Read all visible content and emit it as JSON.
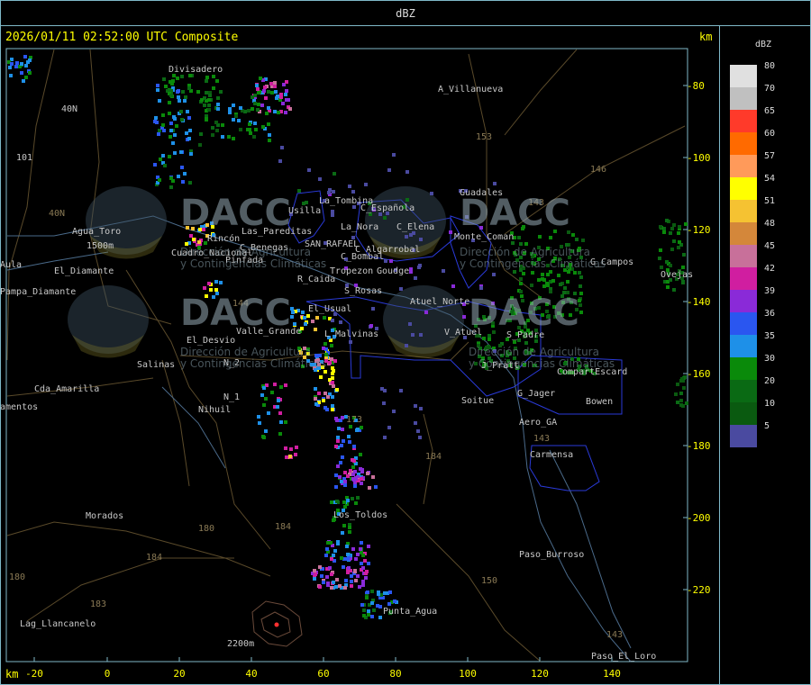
{
  "header": {
    "title": "dBZ"
  },
  "map": {
    "timestamp": "2026/01/11 02:52:00 UTC Composite",
    "unit_label": "km",
    "x_ticks": [
      "-20",
      "0",
      "20",
      "40",
      "60",
      "80",
      "100",
      "120",
      "140"
    ],
    "y_ticks": [
      "-80",
      "-100",
      "-120",
      "-140",
      "-160",
      "-180",
      "-200",
      "-220"
    ],
    "places": [
      {
        "name": "Divisadero"
      },
      {
        "name": "A_Villanueva"
      },
      {
        "name": "40N"
      },
      {
        "name": "101"
      },
      {
        "name": "Guadales"
      },
      {
        "name": "La_Tombina"
      },
      {
        "name": "Usilla"
      },
      {
        "name": "C_Española"
      },
      {
        "name": "C_Elena"
      },
      {
        "name": "Agua_Toro"
      },
      {
        "name": "1500m"
      },
      {
        "name": "Rincón"
      },
      {
        "name": "Las_Pareditas"
      },
      {
        "name": "Cuadro_Nacional"
      },
      {
        "name": "La_Nora"
      },
      {
        "name": "SAN_RAFAEL"
      },
      {
        "name": "C_Algarrobal"
      },
      {
        "name": "C_Benegas"
      },
      {
        "name": "C_Bombal"
      },
      {
        "name": "Pinfada"
      },
      {
        "name": "Tropezon"
      },
      {
        "name": "Goudge"
      },
      {
        "name": "Monte_Coman"
      },
      {
        "name": "Aula"
      },
      {
        "name": "Pampa_Diamante"
      },
      {
        "name": "El_Diamante"
      },
      {
        "name": "R_Caida"
      },
      {
        "name": "S_Rosas"
      },
      {
        "name": "Atuel_Norte"
      },
      {
        "name": "El_Usual"
      },
      {
        "name": "Valle_Grande"
      },
      {
        "name": "L_Malvinas"
      },
      {
        "name": "V_Atuel"
      },
      {
        "name": "El_Desvio"
      },
      {
        "name": "Salinas"
      },
      {
        "name": "N_2"
      },
      {
        "name": "J_Pratt"
      },
      {
        "name": "CompartEscard"
      },
      {
        "name": "Cda_Amarilla"
      },
      {
        "name": "N_1"
      },
      {
        "name": "Nihuil"
      },
      {
        "name": "Soitue"
      },
      {
        "name": "G_Jager"
      },
      {
        "name": "Bowen"
      },
      {
        "name": "amentos"
      },
      {
        "name": "Aero_GA"
      },
      {
        "name": "Carmensa"
      },
      {
        "name": "Morados"
      },
      {
        "name": "Los_Toldos"
      },
      {
        "name": "Paso_Burroso"
      },
      {
        "name": "Punta_Agua"
      },
      {
        "name": "Lag_Llancanelo"
      },
      {
        "name": "2200m"
      },
      {
        "name": "Paso_El_Loro"
      },
      {
        "name": "G_Campos"
      },
      {
        "name": "Ovejas"
      },
      {
        "name": "S_Padre"
      }
    ],
    "routes": [
      "153",
      "146",
      "143",
      "144",
      "173",
      "184",
      "180",
      "184",
      "183",
      "184",
      "180",
      "150",
      "143",
      "143",
      "40N"
    ],
    "watermarks": [
      {
        "logo": "DACC",
        "line1": "Dirección de Agricultura",
        "line2": "y Contingencias Climáticas"
      },
      {
        "logo": "DACC",
        "line1": "Dirección de Agricultura",
        "line2": "y Contingencias Climáticas"
      },
      {
        "logo": "DACC",
        "line1": "Dirección de Agricultura",
        "line2": "y Contingencias Climáticas"
      },
      {
        "logo": "DACC",
        "line1": "Dirección de Agricultura",
        "line2": "y Contingencias Climáticas"
      }
    ]
  },
  "legend": {
    "title": "dBZ",
    "items": [
      {
        "label": "80",
        "color": "#e0e0e0"
      },
      {
        "label": "70",
        "color": "#c0c0c0"
      },
      {
        "label": "65",
        "color": "#ff3a2a"
      },
      {
        "label": "60",
        "color": "#ff6a00"
      },
      {
        "label": "57",
        "color": "#ff9a5a"
      },
      {
        "label": "54",
        "color": "#ffff00"
      },
      {
        "label": "51",
        "color": "#f5c232"
      },
      {
        "label": "48",
        "color": "#d4873a"
      },
      {
        "label": "45",
        "color": "#c8709a"
      },
      {
        "label": "42",
        "color": "#d01ea0"
      },
      {
        "label": "39",
        "color": "#8a2ad8"
      },
      {
        "label": "36",
        "color": "#2a56f0"
      },
      {
        "label": "35",
        "color": "#1e90e8"
      },
      {
        "label": "30",
        "color": "#0a8a0a"
      },
      {
        "label": "20",
        "color": "#0a6a14"
      },
      {
        "label": "10",
        "color": "#0a5a10"
      },
      {
        "label": "5",
        "color": "#4a4aa0"
      }
    ]
  }
}
